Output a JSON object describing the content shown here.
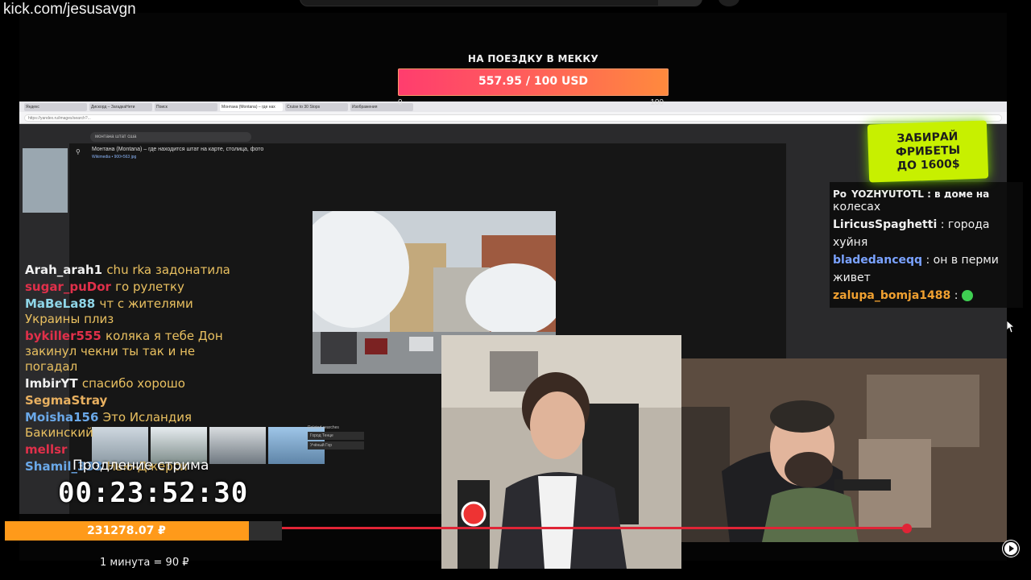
{
  "url_overlay": "kick.com/jesusavgn",
  "donation_goal": {
    "title": "НА ПОЕЗДКУ В МЕККУ",
    "progress_text": "557.95 / 100 USD",
    "min_label": "0",
    "max_label": "100",
    "progress_fraction": 1.0
  },
  "browser": {
    "tabs": [
      "Яндекс",
      "Дискорд – ЗагадкаНети",
      "Поиск",
      "Монтана (Montana) – где нах",
      "Cruise to 30 Stops",
      "Изображения"
    ],
    "address": "https://yandex.ru/images/search?...",
    "search_text": "монтана штат сша",
    "viewer_title": "Монтана (Montana) – где находится штат на карте, столица, фото",
    "viewer_source": "Wikimedia • 900×563 jpg",
    "related_label": "Related searches",
    "related_items": [
      "Город Тенце",
      "Учёный Гор"
    ]
  },
  "chat_left": [
    {
      "user": "Arah_arah1",
      "text": "chu rka задонатила"
    },
    {
      "user": "sugar_puDor",
      "text": "го рулетку"
    },
    {
      "user": "MaBeLa88",
      "text": "чт с жителями Украины плиз"
    },
    {
      "user": "bykiller555",
      "text": "коляка я тебе Дон закинул чекни ты так и не погадал"
    },
    {
      "user": "ImbirYT",
      "text": "спасибо хорошо"
    },
    {
      "user": "SegmaStray",
      "text": ""
    },
    {
      "user": "Moisha156",
      "text": "Это Исландия Бакинский"
    },
    {
      "user": "mellsr",
      "text": ""
    },
    {
      "user": "Shamil_333",
      "text": "Нью-Джерси"
    }
  ],
  "chat_right": {
    "partial_line": "Po_YOZHYUTOTL : в доме на",
    "messages": [
      {
        "user": "",
        "text": "колесах"
      },
      {
        "user": "LiricusSpaghetti",
        "text": " : города хуйня"
      },
      {
        "user": "bladedanceqq",
        "text": " : он в перми живет"
      },
      {
        "user": "zalupa_bomja1488",
        "text": " :"
      }
    ]
  },
  "promo": {
    "line1": "ЗАБИРАЙ",
    "line2": "ФРИБЕТЫ",
    "line3": "ДО 1600$"
  },
  "subathon": {
    "title": "Продление стрима",
    "timer": "00:23:52:30",
    "total": "231278.07 ₽",
    "total_fraction": 0.88,
    "rate": "1 минута = 90 ₽"
  },
  "colors": {
    "goal_start": "#ff3d6e",
    "goal_end": "#ff8a3d",
    "promo_bg": "#c7f000",
    "total_fill": "#ff9a1a",
    "accent_red": "#e02436"
  },
  "icons": [
    "search-icon",
    "mouse-cursor-icon",
    "kick-play-icon",
    "emote-icon"
  ]
}
